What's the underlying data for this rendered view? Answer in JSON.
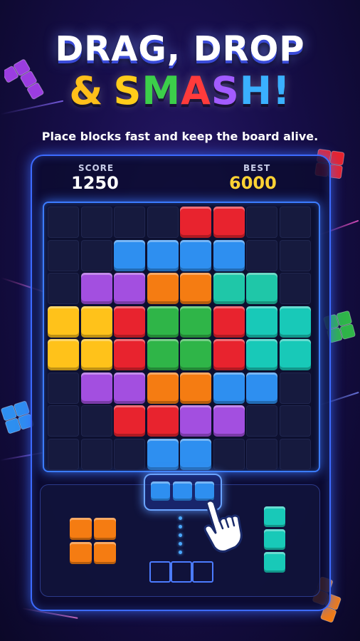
{
  "headline": {
    "line1": "DRAG, DROP",
    "amp": "&",
    "word": [
      {
        "ch": "S",
        "color": "#ffcc1a"
      },
      {
        "ch": "M",
        "color": "#3ccf4a"
      },
      {
        "ch": "A",
        "color": "#ff3b3b"
      },
      {
        "ch": "S",
        "color": "#a25bff"
      },
      {
        "ch": "H",
        "color": "#3ab0ff"
      },
      {
        "ch": "!",
        "color": "#3ab0ff"
      }
    ]
  },
  "tagline": "Place blocks fast and keep the board alive.",
  "score": {
    "label": "SCORE",
    "value": "1250"
  },
  "best": {
    "label": "BEST",
    "value": "6000"
  },
  "colors": {
    "R": "#e8232e",
    "B": "#2e8ff0",
    "P": "#a34fe0",
    "O": "#f57c12",
    "T": "#1fc7a8",
    "Y": "#ffc21a",
    "G": "#2fb548",
    "C": "#18c9b8",
    "accent": "#3d6bff",
    "best": "#ffd234"
  },
  "board": {
    "rows": [
      "....RR..",
      "..BBBB..",
      ".PPOOTT.",
      "YYRGGRCC",
      "YYRGGRCC",
      ".PPOOBB.",
      "..RRPP..",
      "...BB..."
    ]
  },
  "tray": {
    "pieces": [
      {
        "name": "orange-square-piece",
        "color": "O",
        "shape": "2x2"
      },
      {
        "name": "blue-line-piece",
        "color": "B",
        "shape": "1x3 horizontal",
        "selected": true
      },
      {
        "name": "teal-line-piece",
        "color": "C",
        "shape": "3x1 vertical"
      }
    ],
    "icon": "pointing-hand-icon"
  },
  "decor": {
    "floating_blocks": [
      {
        "name": "purple-floating-block",
        "color": "#9b3de0"
      },
      {
        "name": "red-floating-block",
        "color": "#e8232e"
      },
      {
        "name": "green-floating-block",
        "color": "#2fb548"
      },
      {
        "name": "blue-floating-block",
        "color": "#2e8ff0"
      },
      {
        "name": "orange-floating-block",
        "color": "#f57c12"
      }
    ]
  }
}
